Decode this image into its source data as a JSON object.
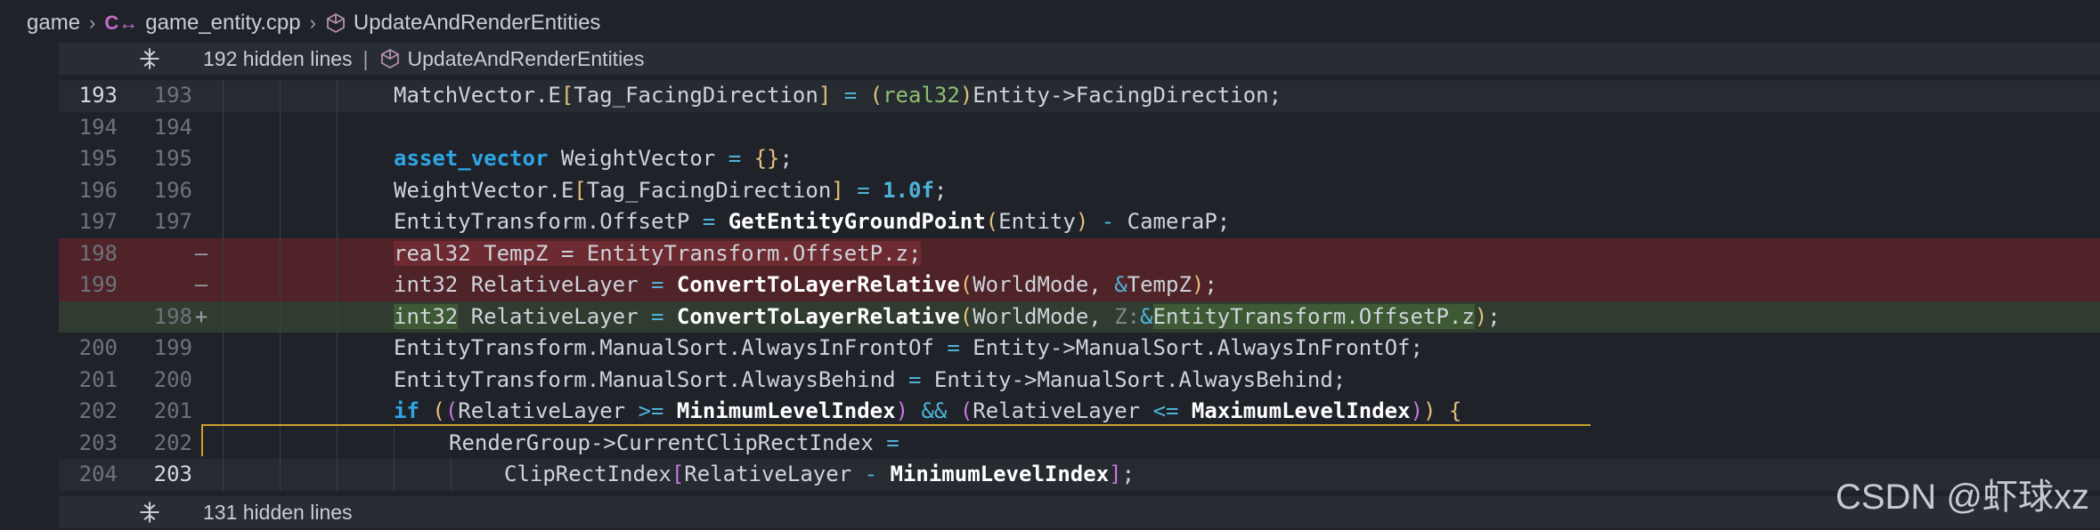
{
  "breadcrumb": {
    "folder": "game",
    "file": "game_entity.cpp",
    "file_lang_icon": "C↔",
    "symbol": "UpdateAndRenderEntities"
  },
  "hidden_top": {
    "text": "192 hidden lines",
    "symbol": "UpdateAndRenderEntities"
  },
  "hidden_bottom": {
    "text": "131 hidden lines"
  },
  "lines": [
    {
      "ln1": "193",
      "ln2": "193",
      "marker": "",
      "kind": "current",
      "tokens": [
        [
          "",
          "MatchVector.E"
        ],
        [
          "bracket-y",
          "["
        ],
        [
          "",
          "Tag_FacingDirection"
        ],
        [
          "bracket-y",
          "]"
        ],
        [
          "op",
          " = "
        ],
        [
          "bracket-y",
          "("
        ],
        [
          "green",
          "real32"
        ],
        [
          "bracket-y",
          ")"
        ],
        [
          "",
          "Entity->FacingDirection;"
        ]
      ]
    },
    {
      "ln1": "194",
      "ln2": "194",
      "marker": "",
      "kind": "normal",
      "tokens": []
    },
    {
      "ln1": "195",
      "ln2": "195",
      "marker": "",
      "kind": "normal",
      "tokens": [
        [
          "kw-b",
          "asset_vector"
        ],
        [
          "",
          " WeightVector "
        ],
        [
          "op",
          "="
        ],
        [
          "",
          " "
        ],
        [
          "bracket-y",
          "{}"
        ],
        [
          "",
          ";"
        ]
      ]
    },
    {
      "ln1": "196",
      "ln2": "196",
      "marker": "",
      "kind": "normal",
      "tokens": [
        [
          "",
          "WeightVector.E"
        ],
        [
          "bracket-y",
          "["
        ],
        [
          "",
          "Tag_FacingDirection"
        ],
        [
          "bracket-y",
          "]"
        ],
        [
          "op",
          " = "
        ],
        [
          "num",
          "1.0f"
        ],
        [
          "",
          ";"
        ]
      ]
    },
    {
      "ln1": "197",
      "ln2": "197",
      "marker": "",
      "kind": "normal",
      "tokens": [
        [
          "",
          "EntityTransform.OffsetP "
        ],
        [
          "op",
          "="
        ],
        [
          "",
          " "
        ],
        [
          "fn",
          "GetEntityGroundPoint"
        ],
        [
          "bracket-y",
          "("
        ],
        [
          "",
          "Entity"
        ],
        [
          "bracket-y",
          ")"
        ],
        [
          "op",
          " - "
        ],
        [
          "",
          "CameraP;"
        ]
      ]
    },
    {
      "ln1": "198",
      "ln2": "",
      "marker": "—",
      "kind": "removed",
      "tokens": [
        [
          "hl",
          "real32 TempZ = EntityTransform.OffsetP.z;"
        ]
      ]
    },
    {
      "ln1": "199",
      "ln2": "",
      "marker": "—",
      "kind": "removed",
      "tokens": [
        [
          "",
          "int32 RelativeLayer "
        ],
        [
          "op",
          "="
        ],
        [
          "",
          " "
        ],
        [
          "fn",
          "ConvertToLayerRelative"
        ],
        [
          "bracket-y",
          "("
        ],
        [
          "",
          "WorldMode, "
        ],
        [
          "op",
          "&"
        ],
        [
          "",
          "TempZ"
        ],
        [
          "bracket-y",
          ")"
        ],
        [
          "",
          ";"
        ]
      ]
    },
    {
      "ln1": "",
      "ln2": "198",
      "marker": "+",
      "kind": "added",
      "tokens": [
        [
          "hl",
          "int32"
        ],
        [
          "",
          " RelativeLayer "
        ],
        [
          "op",
          "="
        ],
        [
          "",
          " "
        ],
        [
          "fn",
          "ConvertToLayerRelative"
        ],
        [
          "bracket-y",
          "("
        ],
        [
          "",
          "WorldMode, "
        ],
        [
          "hint",
          "Z:"
        ],
        [
          "op",
          "&"
        ],
        [
          "hl",
          "EntityTransform.OffsetP.z"
        ],
        [
          "bracket-y",
          ")"
        ],
        [
          "",
          ";"
        ]
      ]
    },
    {
      "ln1": "200",
      "ln2": "199",
      "marker": "",
      "kind": "normal",
      "tokens": [
        [
          "",
          "EntityTransform.ManualSort.AlwaysInFrontOf "
        ],
        [
          "op",
          "="
        ],
        [
          "",
          " Entity->ManualSort.AlwaysInFrontOf;"
        ]
      ]
    },
    {
      "ln1": "201",
      "ln2": "200",
      "marker": "",
      "kind": "normal",
      "tokens": [
        [
          "",
          "EntityTransform.ManualSort.AlwaysBehind "
        ],
        [
          "op",
          "="
        ],
        [
          "",
          " Entity->ManualSort.AlwaysBehind;"
        ]
      ]
    },
    {
      "ln1": "202",
      "ln2": "201",
      "marker": "",
      "kind": "normal",
      "tokens": [
        [
          "kw-b",
          "if"
        ],
        [
          "",
          " "
        ],
        [
          "bracket-y",
          "("
        ],
        [
          "bracket-p",
          "("
        ],
        [
          "",
          "RelativeLayer "
        ],
        [
          "op",
          ">="
        ],
        [
          "",
          " "
        ],
        [
          "fn",
          "MinimumLevelIndex"
        ],
        [
          "bracket-p",
          ")"
        ],
        [
          "op",
          " && "
        ],
        [
          "bracket-p",
          "("
        ],
        [
          "",
          "RelativeLayer "
        ],
        [
          "op",
          "<="
        ],
        [
          "",
          " "
        ],
        [
          "fn",
          "MaximumLevelIndex"
        ],
        [
          "bracket-p",
          ")"
        ],
        [
          "bracket-y",
          ")"
        ],
        [
          "",
          " "
        ],
        [
          "bracket-y",
          "{"
        ]
      ]
    },
    {
      "ln1": "203",
      "ln2": "202",
      "marker": "",
      "kind": "normal",
      "indent": 1,
      "tokens": [
        [
          "",
          "RenderGroup->CurrentClipRectIndex "
        ],
        [
          "op",
          "="
        ]
      ]
    },
    {
      "ln1": "204",
      "ln2": "203",
      "marker": "",
      "kind": "current",
      "indent": 2,
      "tokens": [
        [
          "",
          "ClipRectIndex"
        ],
        [
          "bracket-p",
          "["
        ],
        [
          "",
          "RelativeLayer "
        ],
        [
          "op",
          "-"
        ],
        [
          "",
          " "
        ],
        [
          "fn",
          "MinimumLevelIndex"
        ],
        [
          "bracket-p",
          "]"
        ],
        [
          "",
          ";"
        ]
      ]
    }
  ],
  "watermark": "CSDN @虾球xz"
}
